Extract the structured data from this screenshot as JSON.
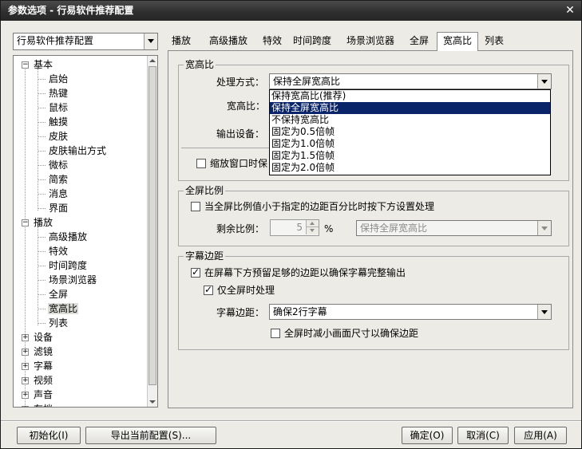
{
  "window": {
    "title": "参数选项 - 行易软件推荐配置",
    "close_glyph": "✕"
  },
  "profile_select": {
    "value": "行易软件推荐配置"
  },
  "tree": {
    "groups": [
      {
        "label": "基本",
        "expanded": true,
        "children": [
          "启始",
          "热键",
          "鼠标",
          "触摸",
          "皮肤",
          "皮肤输出方式",
          "微标",
          "简索",
          "消息",
          "界面"
        ]
      },
      {
        "label": "播放",
        "expanded": true,
        "children": [
          "高级播放",
          "特效",
          "时间跨度",
          "场景浏览器",
          "全屏",
          "宽高比",
          "列表"
        ]
      },
      {
        "label": "设备",
        "expanded": false
      },
      {
        "label": "滤镜",
        "expanded": false
      },
      {
        "label": "字幕",
        "expanded": false
      },
      {
        "label": "视频",
        "expanded": false
      },
      {
        "label": "声音",
        "expanded": false
      },
      {
        "label": "存档",
        "expanded": false
      }
    ],
    "selected": "宽高比"
  },
  "tabs": [
    "播放",
    "高级播放",
    "特效",
    "时间跨度",
    "场景浏览器",
    "全屏",
    "宽高比",
    "列表"
  ],
  "active_tab": "宽高比",
  "aspect": {
    "group_title": "宽高比",
    "mode_label": "处理方式：",
    "mode_value": "保持全屏宽高比",
    "ratio_label": "宽高比：",
    "output_label": "输出设备：",
    "scale_checkbox": "缩放窗口时保",
    "dropdown_options": [
      "保持宽高比(推荐)",
      "保持全屏宽高比",
      "不保持宽高比",
      "固定为0.5倍帧",
      "固定为1.0倍帧",
      "固定为1.5倍帧",
      "固定为2.0倍帧"
    ],
    "dropdown_highlighted": "保持全屏宽高比"
  },
  "fullscreen_ratio": {
    "group_title": "全屏比例",
    "checkbox": "当全屏比例值小于指定的边距百分比时按下方设置处理",
    "checked": false,
    "remain_label": "剩余比例：",
    "remain_value": "5",
    "unit": "%",
    "mode_value": "保持全屏宽高比"
  },
  "subtitle_margin": {
    "group_title": "字幕边距",
    "checkbox1": "在屏幕下方预留足够的边距以确保字幕完整输出",
    "checkbox1_checked": true,
    "checkbox2": "仅全屏时处理",
    "checkbox2_checked": true,
    "margin_label": "字幕边距：",
    "margin_value": "确保2行字幕",
    "checkbox3": "全屏时减小画面尺寸以确保边距",
    "checkbox3_checked": false
  },
  "buttons": {
    "init": "初始化(I)",
    "export": "导出当前配置(S)...",
    "ok": "确定(O)",
    "cancel": "取消(C)",
    "apply": "应用(A)"
  }
}
